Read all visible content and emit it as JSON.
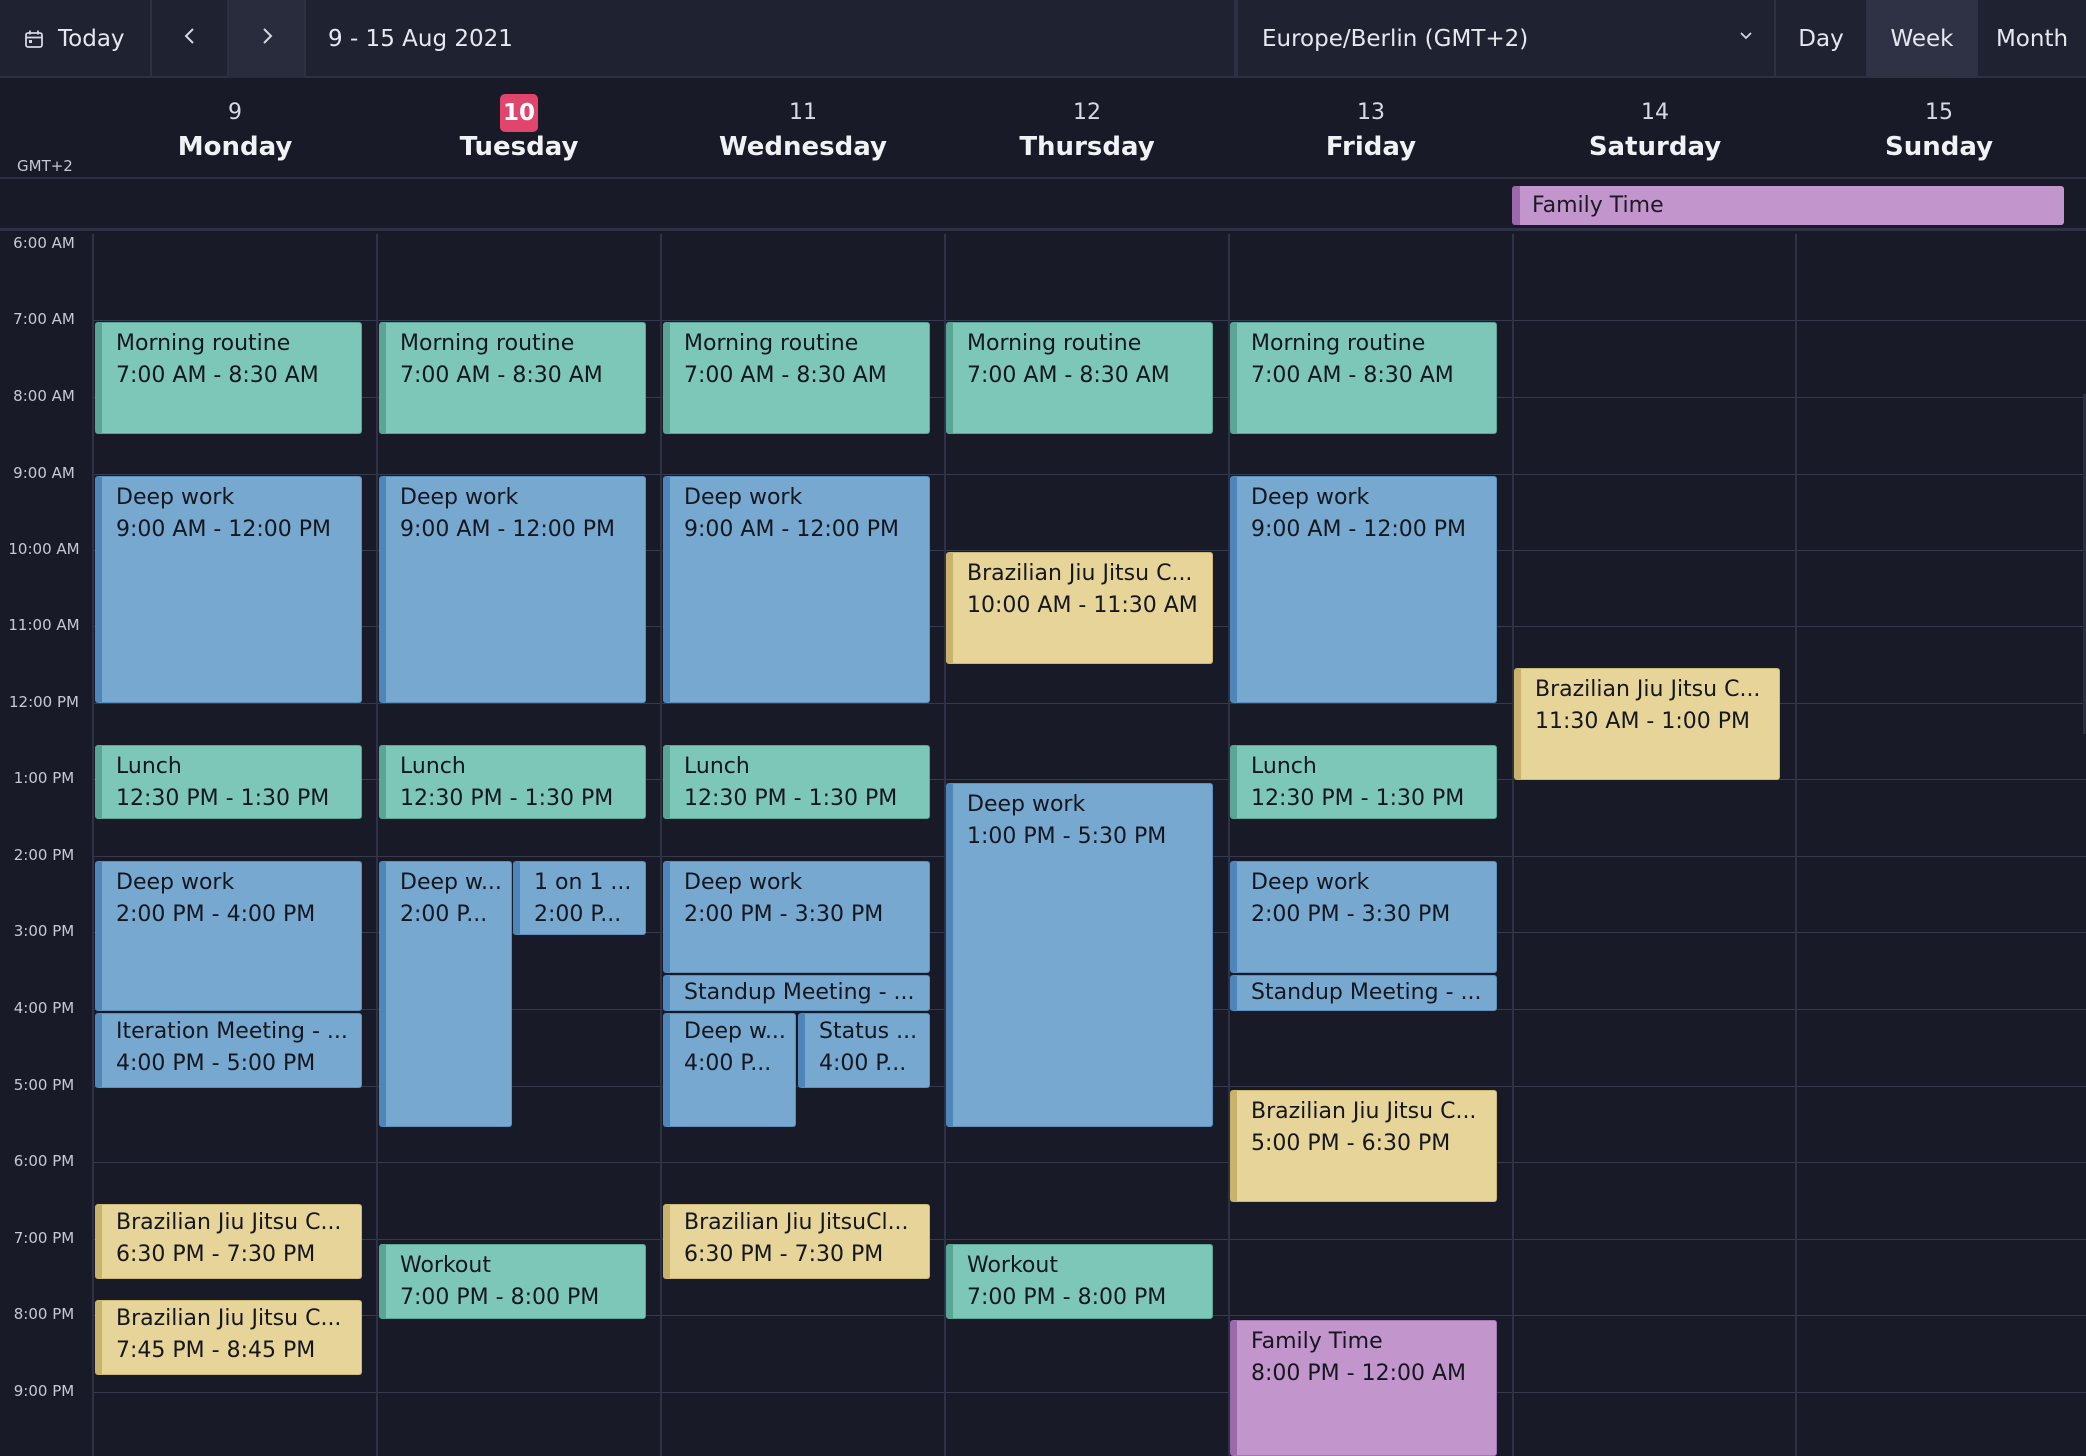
{
  "toolbar": {
    "today_label": "Today",
    "range_label": "9 - 15 Aug 2021",
    "timezone": "Europe/Berlin (GMT+2)",
    "views": [
      "Day",
      "Week",
      "Month"
    ],
    "active_view": "Week"
  },
  "header": {
    "gmt_label": "GMT+2",
    "days": [
      {
        "num": "9",
        "name": "Monday"
      },
      {
        "num": "10",
        "name": "Tuesday"
      },
      {
        "num": "11",
        "name": "Wednesday"
      },
      {
        "num": "12",
        "name": "Thursday"
      },
      {
        "num": "13",
        "name": "Friday"
      },
      {
        "num": "14",
        "name": "Saturday"
      },
      {
        "num": "15",
        "name": "Sunday"
      }
    ]
  },
  "allday": {
    "title": "Family Time"
  },
  "hours": [
    "6:00 AM",
    "7:00 AM",
    "8:00 AM",
    "9:00 AM",
    "10:00 AM",
    "11:00 AM",
    "12:00 PM",
    "1:00 PM",
    "2:00 PM",
    "3:00 PM",
    "4:00 PM",
    "5:00 PM",
    "6:00 PM",
    "7:00 PM",
    "8:00 PM",
    "9:00 PM"
  ],
  "events": {
    "mon_morning": {
      "title": "Morning routine",
      "time": "7:00 AM - 8:30 AM"
    },
    "mon_deep1": {
      "title": "Deep work",
      "time": "9:00 AM - 12:00 PM"
    },
    "mon_lunch": {
      "title": "Lunch",
      "time": "12:30 PM - 1:30 PM"
    },
    "mon_deep2": {
      "title": "Deep work",
      "time": "2:00 PM - 4:00 PM"
    },
    "mon_iter": {
      "title": "Iteration Meeting - ...",
      "time": "4:00 PM - 5:00 PM"
    },
    "mon_bjj1": {
      "title": "Brazilian Jiu Jitsu C...",
      "time": "6:30 PM - 7:30 PM"
    },
    "mon_bjj2": {
      "title": "Brazilian Jiu Jitsu C...",
      "time": "7:45 PM - 8:45 PM"
    },
    "tue_morning": {
      "title": "Morning routine",
      "time": "7:00 AM - 8:30 AM"
    },
    "tue_deep1": {
      "title": "Deep work",
      "time": "9:00 AM - 12:00 PM"
    },
    "tue_lunch": {
      "title": "Lunch",
      "time": "12:30 PM - 1:30 PM"
    },
    "tue_deep2": {
      "title": "Deep w...",
      "time": "2:00 P..."
    },
    "tue_1on1": {
      "title": "1 on 1 ...",
      "time": "2:00 P..."
    },
    "tue_workout": {
      "title": "Workout",
      "time": "7:00 PM - 8:00 PM"
    },
    "wed_morning": {
      "title": "Morning routine",
      "time": "7:00 AM - 8:30 AM"
    },
    "wed_deep1": {
      "title": "Deep work",
      "time": "9:00 AM - 12:00 PM"
    },
    "wed_lunch": {
      "title": "Lunch",
      "time": "12:30 PM - 1:30 PM"
    },
    "wed_deep2": {
      "title": "Deep work",
      "time": "2:00 PM - 3:30 PM"
    },
    "wed_standup": {
      "title": "Standup Meeting - ..."
    },
    "wed_deep3": {
      "title": "Deep w...",
      "time": "4:00 P..."
    },
    "wed_status": {
      "title": "Status ...",
      "time": "4:00 P..."
    },
    "wed_bjj": {
      "title": "Brazilian Jiu JitsuCl...",
      "time": "6:30 PM - 7:30 PM"
    },
    "thu_morning": {
      "title": "Morning routine",
      "time": "7:00 AM - 8:30 AM"
    },
    "thu_bjj": {
      "title": "Brazilian Jiu Jitsu C...",
      "time": "10:00 AM - 11:30 AM"
    },
    "thu_deep": {
      "title": "Deep work",
      "time": "1:00 PM - 5:30 PM"
    },
    "thu_workout": {
      "title": "Workout",
      "time": "7:00 PM - 8:00 PM"
    },
    "fri_morning": {
      "title": "Morning routine",
      "time": "7:00 AM - 8:30 AM"
    },
    "fri_deep1": {
      "title": "Deep work",
      "time": "9:00 AM - 12:00 PM"
    },
    "fri_lunch": {
      "title": "Lunch",
      "time": "12:30 PM - 1:30 PM"
    },
    "fri_deep2": {
      "title": "Deep work",
      "time": "2:00 PM - 3:30 PM"
    },
    "fri_standup": {
      "title": "Standup Meeting - ..."
    },
    "fri_bjj": {
      "title": "Brazilian Jiu Jitsu C...",
      "time": "5:00 PM - 6:30 PM"
    },
    "fri_family": {
      "title": "Family Time",
      "time": "8:00 PM - 12:00 AM"
    },
    "sat_bjj": {
      "title": "Brazilian Jiu Jitsu C...",
      "time": "11:30 AM - 1:00 PM"
    }
  },
  "colors": {
    "background": "#181b27",
    "today_badge": "#e0456d",
    "green_event": "#7dc7b8",
    "blue_event": "#76a8d0",
    "yellow_event": "#e6d498",
    "purple_event": "#c295cc"
  }
}
